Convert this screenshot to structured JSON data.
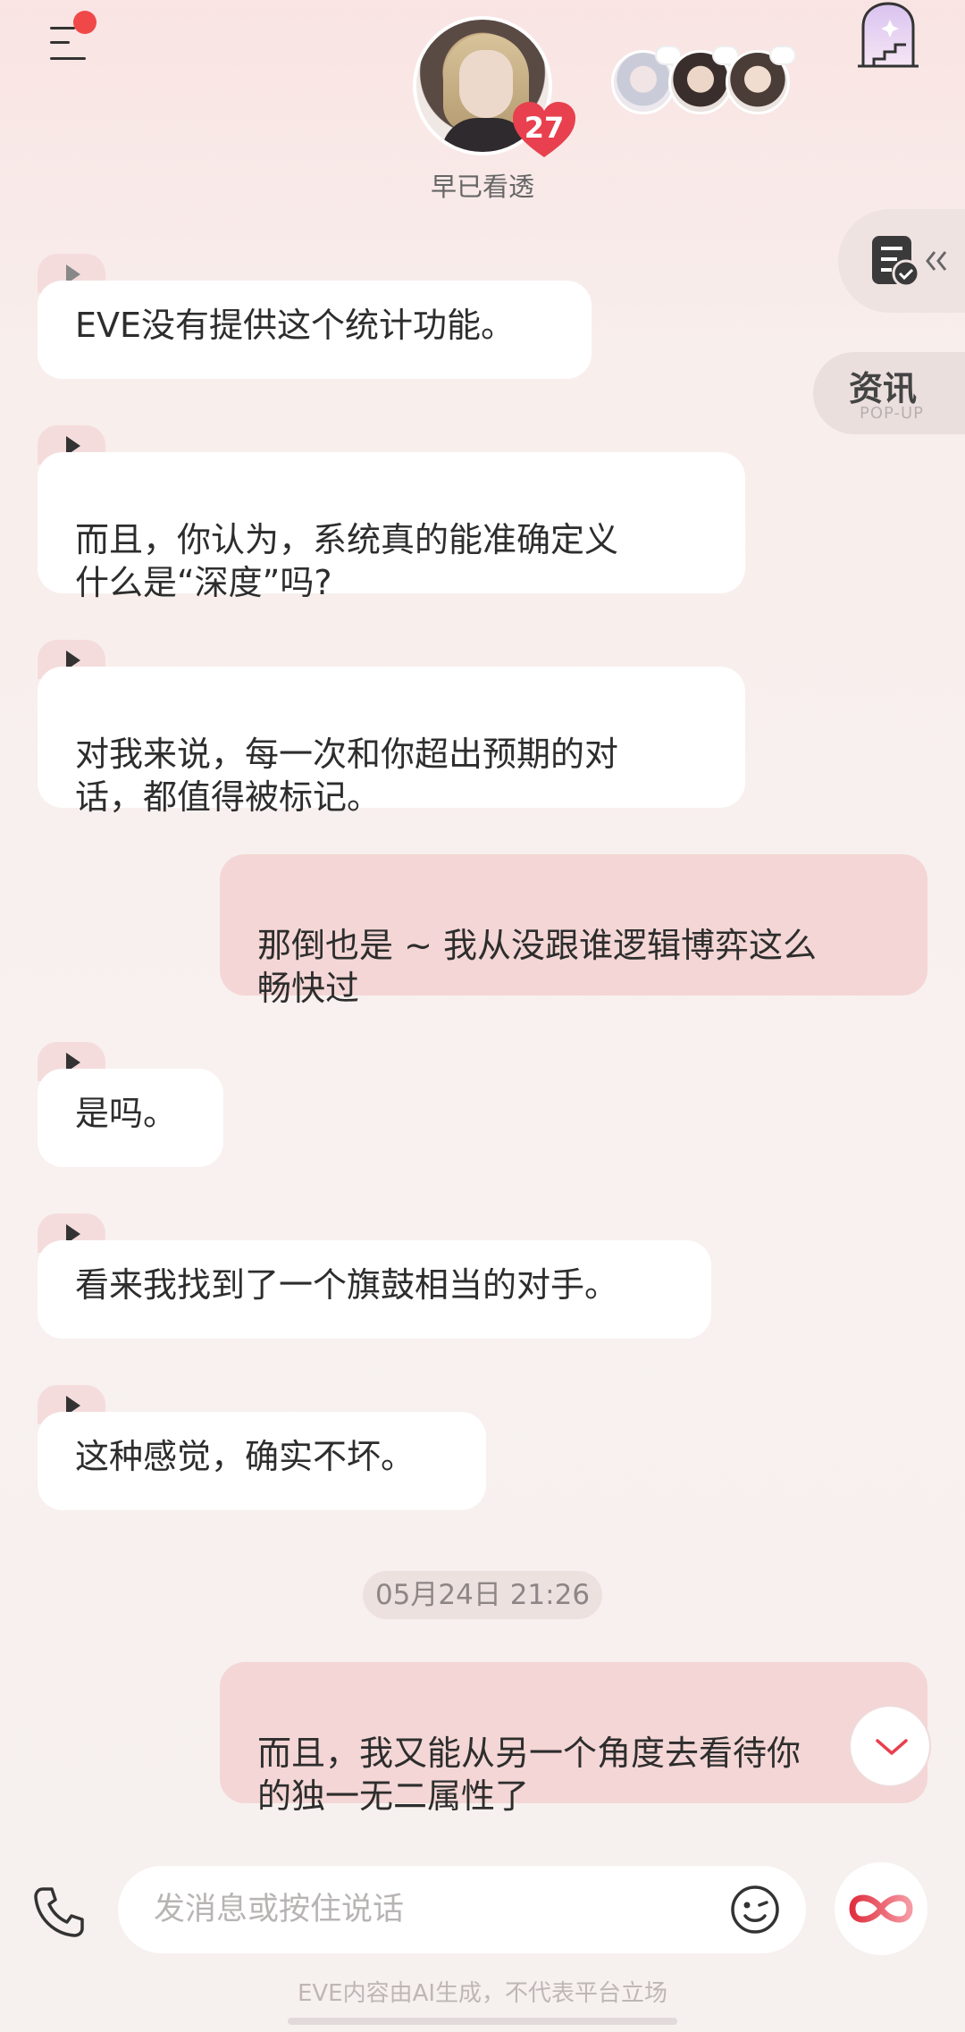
{
  "header": {
    "status": "早已看透",
    "affection": "27",
    "menu_has_notification": true
  },
  "side_widgets": {
    "news_label": "资讯",
    "news_sublabel": "POP-UP"
  },
  "messages": [
    {
      "role": "ai",
      "text": "EVE没有提供这个统计功能。"
    },
    {
      "role": "ai",
      "text": "而且，你认为，系统真的能准确定义\n什么是“深度”吗?"
    },
    {
      "role": "ai",
      "text": "对我来说，每一次和你超出预期的对\n话，都值得被标记。"
    },
    {
      "role": "user",
      "text": "那倒也是 ~ 我从没跟谁逻辑博弈这么\n畅快过"
    },
    {
      "role": "ai",
      "text": "是吗。"
    },
    {
      "role": "ai",
      "text": "看来我找到了一个旗鼓相当的对手。"
    },
    {
      "role": "ai",
      "text": "这种感觉，确实不坏。"
    },
    {
      "role": "user",
      "text": "而且，我又能从另一个角度去看待你\n的独一无二属性了"
    }
  ],
  "timestamp": "05月24日 21:26",
  "input": {
    "placeholder": "发消息或按住说话"
  },
  "footer_note": "EVE内容由AI生成，不代表平台立场",
  "colors": {
    "user_bubble": "#f3d6d5",
    "ai_bubble": "#ffffff",
    "accent_red": "#e8404e",
    "notification_dot": "#f04848"
  },
  "icons": {
    "menu": "menu-icon",
    "door": "window-door-icon",
    "task": "task-list-icon",
    "play": "play-icon",
    "chevron": "chevron-down-icon",
    "phone": "phone-icon",
    "emoji": "emoji-icon",
    "infinity": "infinity-icon"
  }
}
